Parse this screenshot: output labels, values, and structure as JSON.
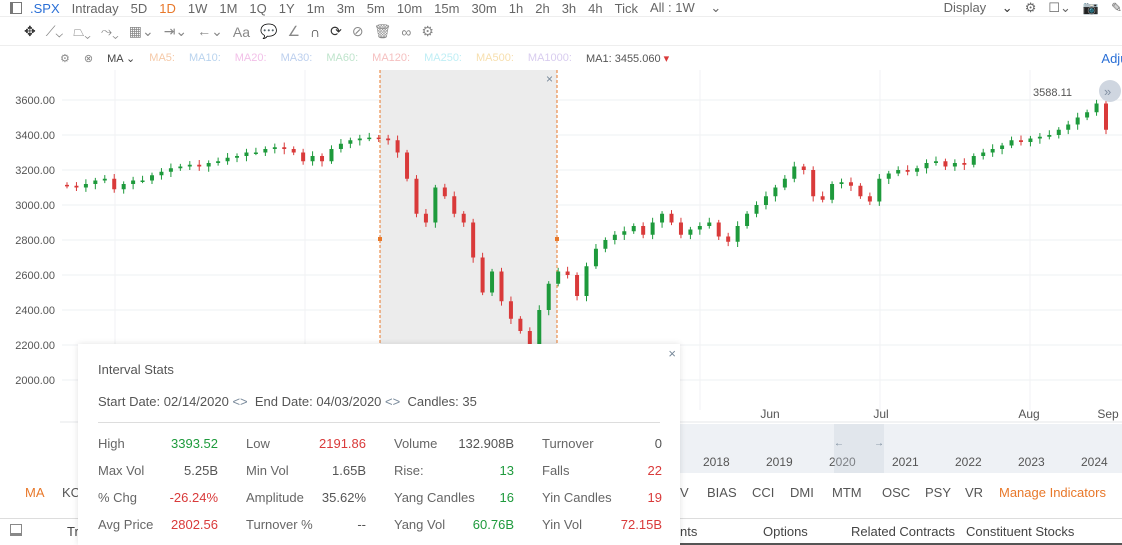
{
  "topbar": {
    "symbol": ".SPX",
    "periods": [
      "Intraday",
      "5D",
      "1D",
      "1W",
      "1M",
      "1Q",
      "1Y",
      "1m",
      "3m",
      "5m",
      "10m",
      "15m",
      "30m",
      "1h",
      "2h",
      "3h",
      "4h",
      "Tick"
    ],
    "active_period": "1D",
    "range": "All : 1W",
    "display": "Display"
  },
  "toolbar": {
    "icons": [
      "move-icon",
      "line-icon",
      "polyline-icon",
      "path-icon",
      "fib-icon",
      "measure-icon",
      "arrow-icon",
      "text-icon",
      "comment-icon",
      "angle-icon",
      "magnet-icon",
      "sync-icon",
      "hide-icon",
      "trash-icon",
      "link-icon",
      "settings-icon"
    ],
    "text_tool": "Aa"
  },
  "mabar": {
    "name": "MA",
    "items": [
      {
        "label": "MA5:",
        "color": "#f5c9a8"
      },
      {
        "label": "MA10:",
        "color": "#b9d3ee"
      },
      {
        "label": "MA20:",
        "color": "#f2c0e8"
      },
      {
        "label": "MA30:",
        "color": "#bccfee"
      },
      {
        "label": "MA60:",
        "color": "#bfe4cc"
      },
      {
        "label": "MA120:",
        "color": "#f5c0c0"
      },
      {
        "label": "MA250:",
        "color": "#bfeef5"
      },
      {
        "label": "MA500:",
        "color": "#f7dfae"
      },
      {
        "label": "MA1000:",
        "color": "#d8ccef"
      }
    ],
    "ma1_label": "MA1:",
    "ma1_value": "3455.060",
    "adjust": "Adjusted"
  },
  "chart_data": {
    "type": "candlestick",
    "y_ticks": [
      "3600.00",
      "3400.00",
      "3200.00",
      "3000.00",
      "2800.00",
      "2600.00",
      "2400.00",
      "2200.00",
      "2000.00"
    ],
    "ylim": [
      1900,
      3700
    ],
    "x_ticks": [
      "Jun",
      "Jul",
      "Aug",
      "Sep"
    ],
    "last_label": "3588.11",
    "up_color": "#1e9a3c",
    "down_color": "#d93a3a",
    "closes": [
      3110,
      3100,
      3120,
      3140,
      3150,
      3090,
      3120,
      3140,
      3140,
      3170,
      3190,
      3210,
      3220,
      3230,
      3220,
      3240,
      3250,
      3270,
      3280,
      3300,
      3300,
      3320,
      3330,
      3320,
      3300,
      3250,
      3280,
      3250,
      3320,
      3350,
      3370,
      3380,
      3385,
      3380,
      3370,
      3300,
      3150,
      2950,
      2900,
      3100,
      3050,
      2950,
      2900,
      2700,
      2500,
      2620,
      2450,
      2350,
      2280,
      2200,
      2400,
      2550,
      2620,
      2600,
      2480,
      2650,
      2750,
      2800,
      2830,
      2850,
      2880,
      2830,
      2900,
      2950,
      2900,
      2830,
      2860,
      2880,
      2900,
      2820,
      2790,
      2880,
      2950,
      3000,
      3050,
      3100,
      3150,
      3220,
      3200,
      3050,
      3030,
      3120,
      3130,
      3110,
      3050,
      3020,
      3150,
      3180,
      3200,
      3190,
      3210,
      3240,
      3250,
      3220,
      3240,
      3230,
      3280,
      3300,
      3320,
      3340,
      3370,
      3360,
      3380,
      3390,
      3400,
      3430,
      3460,
      3500,
      3530,
      3580,
      3430
    ]
  },
  "interval": {
    "title": "Interval Stats",
    "start_label": "Start Date:",
    "start": "02/14/2020",
    "end_label": "End Date:",
    "end": "04/03/2020",
    "candles_label": "Candles:",
    "candles": "35",
    "rows": [
      [
        {
          "k": "High",
          "v": "3393.52",
          "c": "g"
        },
        {
          "k": "Low",
          "v": "2191.86",
          "c": "r"
        },
        {
          "k": "Volume",
          "v": "132.908B",
          "c": "n"
        },
        {
          "k": "Turnover",
          "v": "0",
          "c": "n"
        }
      ],
      [
        {
          "k": "Max Vol",
          "v": "5.25B",
          "c": "n"
        },
        {
          "k": "Min Vol",
          "v": "1.65B",
          "c": "n"
        },
        {
          "k": "Rise:",
          "v": "13",
          "c": "g"
        },
        {
          "k": "Falls",
          "v": "22",
          "c": "r"
        }
      ],
      [
        {
          "k": "% Chg",
          "v": "-26.24%",
          "c": "r"
        },
        {
          "k": "Amplitude",
          "v": "35.62%",
          "c": "n"
        },
        {
          "k": "Yang Candles",
          "v": "16",
          "c": "g"
        },
        {
          "k": "Yin Candles",
          "v": "19",
          "c": "r"
        }
      ],
      [
        {
          "k": "Avg Price",
          "v": "2802.56",
          "c": "r"
        },
        {
          "k": "Turnover %",
          "v": "--",
          "c": "n"
        },
        {
          "k": "Yang Vol",
          "v": "60.76B",
          "c": "g"
        },
        {
          "k": "Yin Vol",
          "v": "72.15B",
          "c": "r"
        }
      ]
    ]
  },
  "navigator": {
    "years": [
      "2018",
      "2019",
      "2020",
      "2021",
      "2022",
      "2023",
      "2024"
    ]
  },
  "indicators": {
    "left": [
      "MA",
      "KC"
    ],
    "right": [
      "V",
      "BIAS",
      "CCI",
      "DMI",
      "MTM",
      "OSC",
      "PSY",
      "VR"
    ],
    "manage": "Manage Indicators"
  },
  "bottom_tabs": {
    "left": "Tr",
    "items": [
      "nts",
      "Options",
      "Related Contracts",
      "Constituent Stocks"
    ]
  }
}
